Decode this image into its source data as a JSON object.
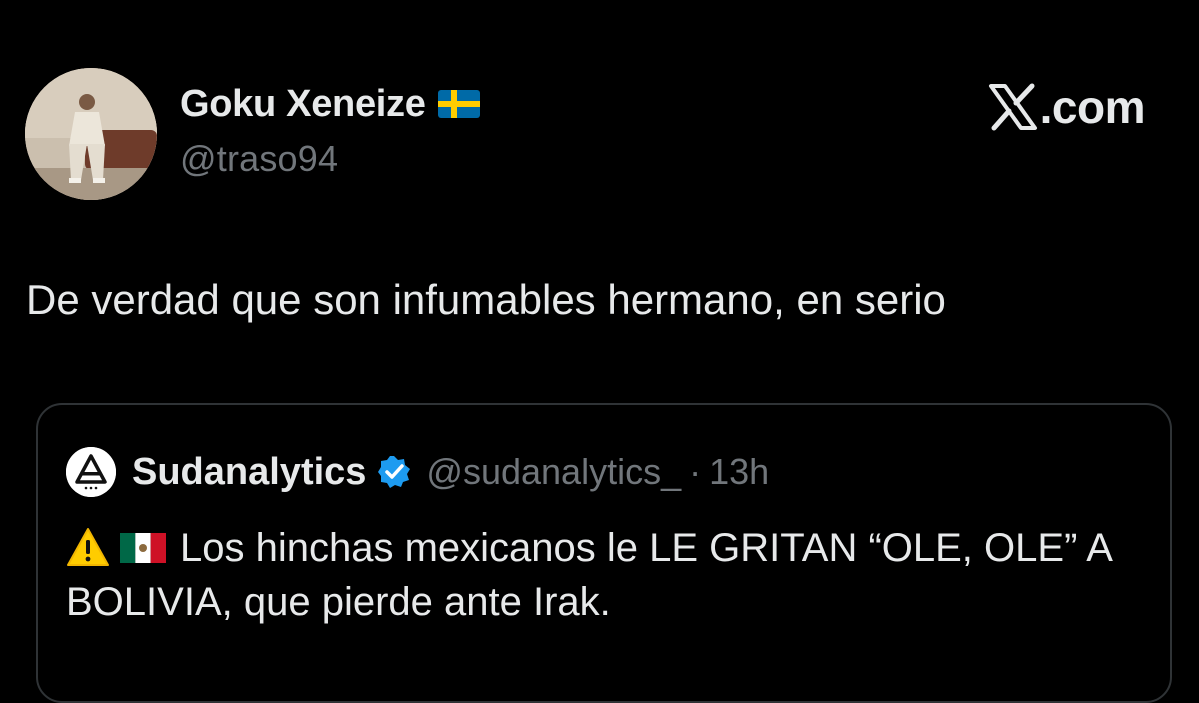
{
  "tweet": {
    "author": {
      "display_name": "Goku Xeneize",
      "flag_icon": "sweden-flag-icon",
      "handle": "@traso94"
    },
    "brand": {
      "logo_icon": "x-logo-icon",
      "suffix": ".com"
    },
    "text": "De verdad que son infumables hermano, en serio"
  },
  "quote": {
    "author_name": "Sudanalytics",
    "verified_icon": "verified-badge-icon",
    "handle": "@sudanalytics_",
    "separator": "·",
    "time": "13h",
    "emoji": [
      "warning-icon",
      "mexico-flag-icon"
    ],
    "text": "Los hinchas mexicanos le LE GRITAN “OLE, OLE” A BOLIVIA, que pierde ante Irak."
  },
  "colors": {
    "background": "#000000",
    "primary_text": "#e7e9ea",
    "secondary_text": "#71767b",
    "border": "#2f3336",
    "verified_blue": "#1d9bf0"
  }
}
